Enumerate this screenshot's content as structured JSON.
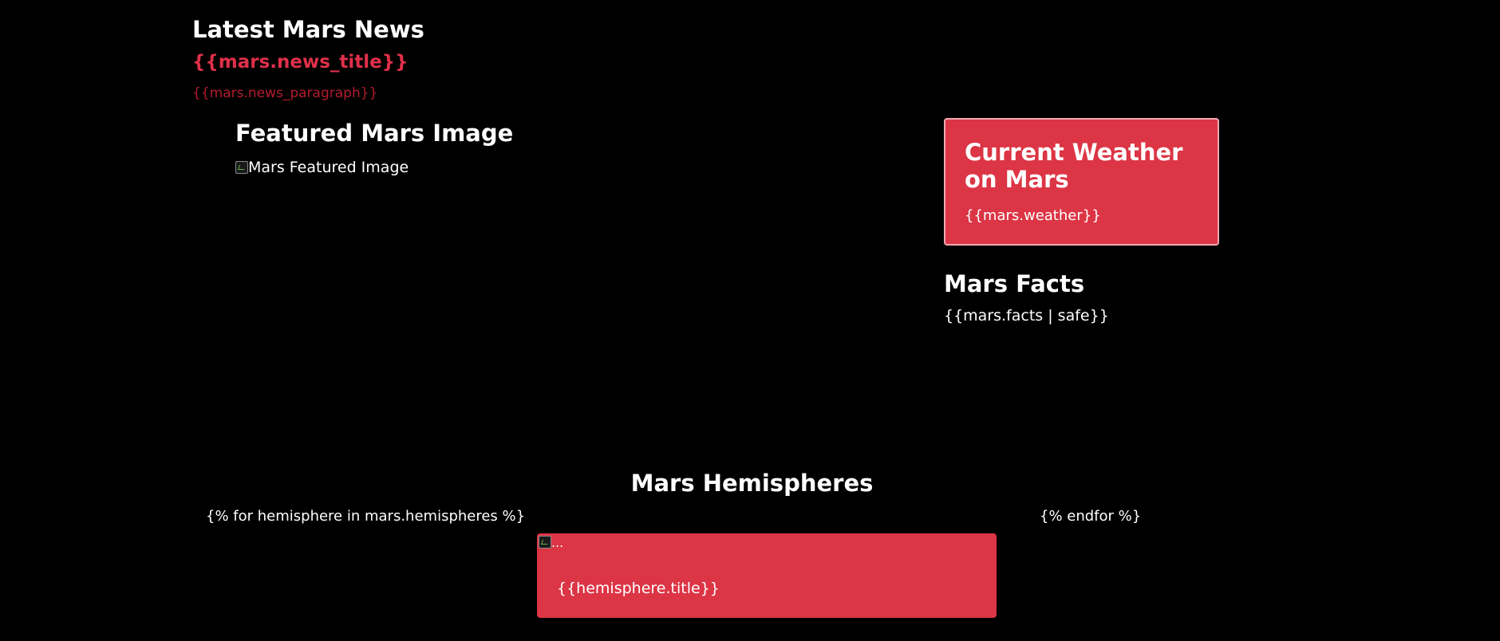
{
  "news": {
    "heading": "Latest Mars News",
    "title": "{{mars.news_title}}",
    "paragraph": "{{mars.news_paragraph}}"
  },
  "featured": {
    "heading": "Featured Mars Image",
    "image_alt": "Mars Featured Image"
  },
  "weather": {
    "title": "Current Weather on Mars",
    "value": "{{mars.weather}}"
  },
  "facts": {
    "heading": "Mars Facts",
    "value": "{{mars.facts | safe}}"
  },
  "hemispheres": {
    "heading": "Mars Hemispheres",
    "loop_start": "{% for hemisphere in mars.hemispheres %}",
    "loop_end": "{% endfor %}",
    "card": {
      "image_alt": "...",
      "title": "{{hemisphere.title}}"
    }
  },
  "colors": {
    "background": "#000000",
    "accent_red": "#dc3545",
    "news_title": "#e0304a",
    "news_paragraph": "#b31c2e",
    "text": "#ffffff"
  }
}
